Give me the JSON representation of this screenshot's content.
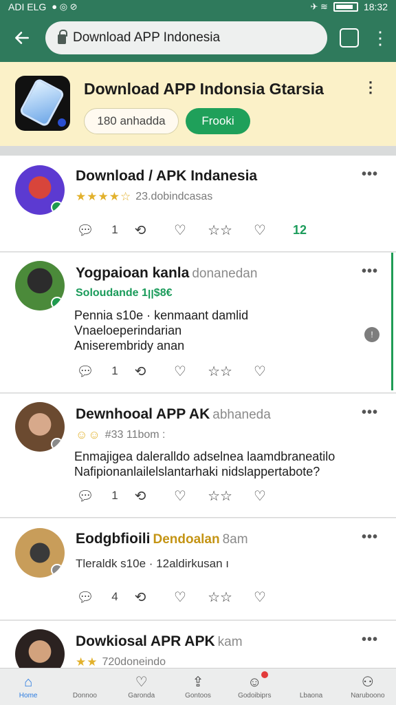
{
  "status_bar": {
    "left_text": "ADI ELG",
    "time": "18:32"
  },
  "browser": {
    "url": "Download APP Indonesia",
    "tabs_count": ""
  },
  "banner": {
    "title": "Download APP Indonsia Gtarsia",
    "downloads_pill": "180 anhadda",
    "action_button": "Frooki"
  },
  "posts": [
    {
      "title": "Download / APK Indanesia",
      "meta": "",
      "sub": "23.dobindcasas",
      "stars": "★★★★☆",
      "comments": "1",
      "extra": "12"
    },
    {
      "title": "Yogpaioan kanla",
      "meta": "donanedan",
      "sub": "Soloudande 1ꞁꞁ$8€",
      "text": [
        "Pennia s10e · kenmaant damlid",
        "Vnaeloeperindarian",
        "Aniserembridy anan"
      ],
      "comments": "1"
    },
    {
      "title": "Dewnhooal APP AK",
      "meta": "abhaneda",
      "sub": "#33 11bom :",
      "text": [
        "Enmajigea daleralldo adselnea laamdbraneatilo",
        "Nafipionanlailelslantarhaki nidslappertabote?"
      ],
      "comments": "1"
    },
    {
      "title": "Eodgbfioili",
      "meta_highlight": "Dendoalan",
      "meta": "8am",
      "sub": "Tleraldk s10e · 12aldirkusan ı",
      "comments": "4"
    },
    {
      "title": "Dowkiosal APR APK",
      "meta": "kam",
      "sub": "720doneindo",
      "stars": "★★"
    }
  ],
  "bottom_nav": [
    {
      "label": "Home",
      "icon": "home-icon"
    },
    {
      "label": "Donnoo",
      "icon": "blank-icon"
    },
    {
      "label": "Garonda",
      "icon": "heart-icon"
    },
    {
      "label": "Gontoos",
      "icon": "share-icon"
    },
    {
      "label": "Godoibiprs",
      "icon": "chat-icon"
    },
    {
      "label": "Lbaona",
      "icon": "blank-icon"
    },
    {
      "label": "Naruboono",
      "icon": "profile-icon"
    }
  ],
  "colors": {
    "brand_green": "#2f7a5c",
    "accent_green": "#1fa05a",
    "banner_bg": "#fbf1c8",
    "star": "#e2b12c"
  }
}
